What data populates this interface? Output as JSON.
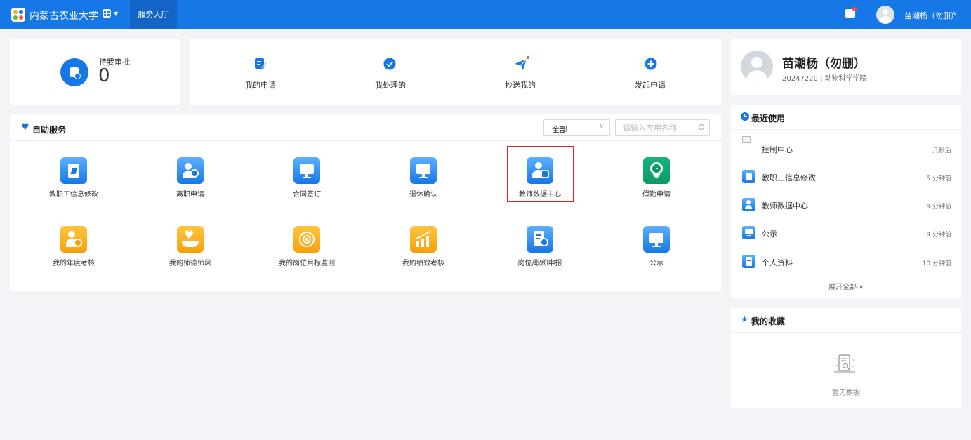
{
  "header": {
    "school_name": "内蒙古农业大学",
    "nav_tab": "服务大厅",
    "user_name": "苗潮杨（勿删）",
    "colors": {
      "primary": "#1677e6",
      "active_tab": "#1265c6"
    }
  },
  "pending": {
    "label": "待我审批",
    "count": "0"
  },
  "quick_actions": [
    {
      "label": "我的申请",
      "icon": "edit-icon"
    },
    {
      "label": "我处理的",
      "icon": "check-circle-icon"
    },
    {
      "label": "抄送我的",
      "icon": "paper-plane-icon"
    },
    {
      "label": "发起申请",
      "icon": "plus-circle-icon"
    }
  ],
  "self_service": {
    "title": "自助服务",
    "filter_value": "全部",
    "search_placeholder": "请输入应用名称",
    "apps": [
      {
        "label": "教职工信息修改",
        "icon": "clipboard-edit-icon",
        "color": "blue"
      },
      {
        "label": "离职申请",
        "icon": "user-remove-icon",
        "color": "blue"
      },
      {
        "label": "合同签订",
        "icon": "monitor-icon",
        "color": "blue"
      },
      {
        "label": "退休确认",
        "icon": "monitor-icon",
        "color": "blue"
      },
      {
        "label": "教师数据中心",
        "icon": "user-database-icon",
        "color": "blue",
        "highlighted": true
      },
      {
        "label": "假勤申请",
        "icon": "location-clock-icon",
        "color": "green"
      },
      {
        "label": "我的年度考核",
        "icon": "user-badge-icon",
        "color": "orange"
      },
      {
        "label": "我的师德师风",
        "icon": "heart-hand-icon",
        "color": "orange"
      },
      {
        "label": "我的岗位目标监测",
        "icon": "target-icon",
        "color": "orange"
      },
      {
        "label": "我的绩效考核",
        "icon": "trend-chart-icon",
        "color": "orange"
      },
      {
        "label": "岗位/职称申报",
        "icon": "document-upload-icon",
        "color": "blue"
      },
      {
        "label": "公示",
        "icon": "monitor-icon",
        "color": "blue"
      }
    ]
  },
  "profile": {
    "name": "苗潮杨（勿删）",
    "info": "20247220 | 动物科学学院"
  },
  "recent": {
    "title": "最近使用",
    "items": [
      {
        "label": "控制中心",
        "time": "几秒后",
        "icon": "broken-image-icon"
      },
      {
        "label": "教职工信息修改",
        "time": "5 分钟前",
        "icon": "clipboard-edit-icon"
      },
      {
        "label": "教师数据中心",
        "time": "9 分钟前",
        "icon": "user-database-icon"
      },
      {
        "label": "公示",
        "time": "9 分钟前",
        "icon": "monitor-icon"
      },
      {
        "label": "个人资料",
        "time": "10 分钟前",
        "icon": "profile-card-icon"
      }
    ],
    "expand_label": "展开全部"
  },
  "favorites": {
    "title": "我的收藏",
    "empty_text": "暂无数据"
  }
}
